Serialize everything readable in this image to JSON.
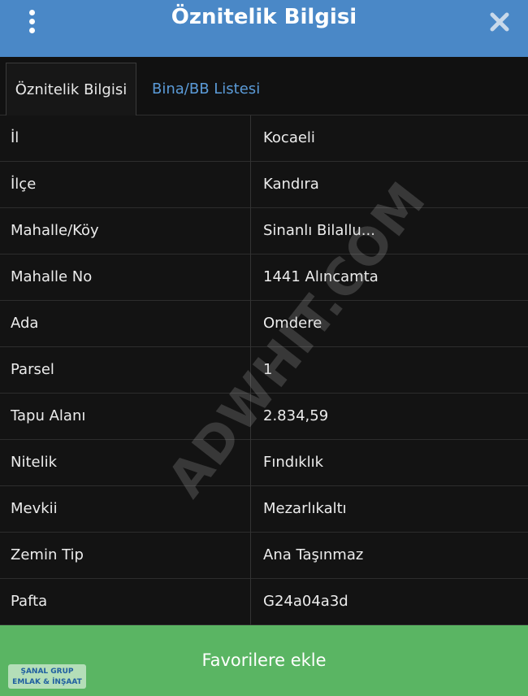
{
  "header": {
    "title": "Öznitelik Bilgisi",
    "menu_icon": "vertical-dots-icon",
    "close_icon": "close-icon"
  },
  "tabs": [
    {
      "label": "Öznitelik Bilgisi",
      "active": true
    },
    {
      "label": "Bina/BB Listesi",
      "active": false
    }
  ],
  "rows": [
    {
      "label": "İl",
      "value": "Kocaeli"
    },
    {
      "label": "İlçe",
      "value": "Kandıra"
    },
    {
      "label": "Mahalle/Köy",
      "value": "Sinanlı Bilallu..."
    },
    {
      "label": "Mahalle No",
      "value": "1441 Alıncamta"
    },
    {
      "label": "Ada",
      "value": "Omdere"
    },
    {
      "label": "Parsel",
      "value": "1"
    },
    {
      "label": "Tapu Alanı",
      "value": "2.834,59"
    },
    {
      "label": "Nitelik",
      "value": "Fındıklık"
    },
    {
      "label": "Mevkii",
      "value": "Mezarlıkaltı"
    },
    {
      "label": "Zemin Tip",
      "value": "Ana Taşınmaz"
    },
    {
      "label": "Pafta",
      "value": "G24a04a3d"
    }
  ],
  "watermark": "ADWHIT.COM",
  "footer": {
    "button_label": "Favorilere ekle",
    "logo_line1": "ŞANAL GRUP",
    "logo_line2": "EMLAK & İNŞAAT"
  },
  "colors": {
    "header": "#4a88c7",
    "tab_inactive": "#5b9bd8",
    "favorite_bar": "#5ab563",
    "background": "#121212"
  }
}
